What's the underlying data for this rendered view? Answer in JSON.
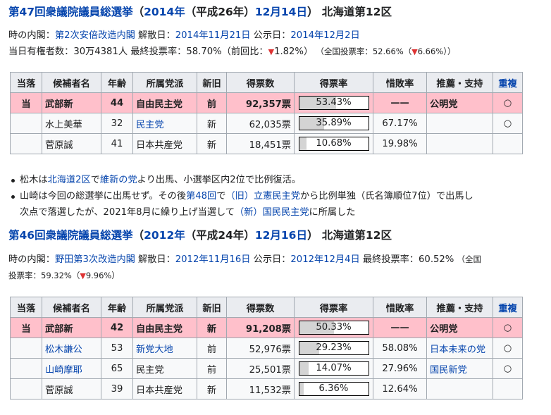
{
  "e47": {
    "heading": {
      "title": "第47回衆議院議員総選挙",
      "p1": "（",
      "year": "2014年",
      "era": "（平成26年）",
      "date": "12月14日",
      "p2": "）",
      "district": "北海道第12区"
    },
    "info": {
      "cabinet_label": "時の内閣：",
      "cabinet": "第2次安倍改造内閣",
      "dissolution_label": "解散日：",
      "dissolution": "2014年11月21日",
      "notice_label": "公示日：",
      "notice": "2014年12月2日"
    },
    "turnout": {
      "voters_label": "当日有権者数：",
      "voters": "30万4381人",
      "rate_label": "最終投票率：",
      "rate": "58.70%",
      "prev_open": "（前回比：",
      "prev_arrow": "▼",
      "prev_value": "1.82%",
      "prev_close": "）",
      "national_open": "（全国投票率：52.66%（",
      "national_arrow": "▼",
      "national_value": "6.66%",
      "national_close": "））"
    },
    "table": {
      "headers": [
        "当落",
        "候補者名",
        "年齢",
        "所属党派",
        "新旧",
        "得票数",
        "得票率",
        "惜敗率",
        "推薦・支持",
        "重複"
      ],
      "rows": [
        {
          "result": "当",
          "name": "武部新",
          "age": "44",
          "party": "自由民主党",
          "status": "前",
          "votes": "92,357票",
          "rate": "53.43%",
          "rate_value": 53.43,
          "loss": "——",
          "support": "公明党",
          "dup": "○"
        },
        {
          "result": "",
          "name": "水上美華",
          "age": "32",
          "party": "民主党",
          "status": "新",
          "votes": "62,035票",
          "rate": "35.89%",
          "rate_value": 35.89,
          "loss": "67.17%",
          "support": "",
          "dup": "○"
        },
        {
          "result": "",
          "name": "菅原誠",
          "age": "41",
          "party": "日本共産党",
          "status": "新",
          "votes": "18,451票",
          "rate": "10.68%",
          "rate_value": 10.68,
          "loss": "19.98%",
          "support": "",
          "dup": ""
        }
      ]
    },
    "notes": [
      {
        "a": "松木は",
        "l1": "北海道2区",
        "b": "で",
        "l2": "維新の党",
        "c": "より出馬、小選挙区内2位で比例復活。"
      },
      {
        "a": "山崎は今回の総選挙に出馬せず。その後",
        "l1": "第48回",
        "b": "で",
        "l2": "（旧）立憲民主党",
        "c": "から比例単独（氏名簿順位7位）で出馬し",
        "d": "次点で落選したが、2021年8月に繰り上げ当選して",
        "l3": "（新）国民民主党",
        "e": "に所属した"
      }
    ]
  },
  "e46": {
    "heading": {
      "title": "第46回衆議院議員総選挙",
      "p1": "（",
      "year": "2012年",
      "era": "（平成24年）",
      "date": "12月16日",
      "p2": "）",
      "district": "北海道第12区"
    },
    "info": {
      "cabinet_label": "時の内閣：",
      "cabinet": "野田第3次改造内閣",
      "dissolution_label": "解散日：",
      "dissolution": "2012年11月16日",
      "notice_label": "公示日：",
      "notice": "2012年12月4日",
      "rate_label": "最終投票率：",
      "rate": "60.52%",
      "national_open": "（全国",
      "national_cont": "投票率：59.32%（",
      "national_arrow": "▼",
      "national_value": "9.96%",
      "national_close": "）"
    },
    "table": {
      "headers": [
        "当落",
        "候補者名",
        "年齢",
        "所属党派",
        "新旧",
        "得票数",
        "得票率",
        "惜敗率",
        "推薦・支持",
        "重複"
      ],
      "rows": [
        {
          "result": "当",
          "name": "武部新",
          "age": "42",
          "party": "自由民主党",
          "status": "新",
          "votes": "91,208票",
          "rate": "50.33%",
          "rate_value": 50.33,
          "loss": "——",
          "support": "公明党",
          "dup": "○"
        },
        {
          "result": "",
          "name": "松木謙公",
          "age": "53",
          "party": "新党大地",
          "status": "前",
          "votes": "52,976票",
          "rate": "29.23%",
          "rate_value": 29.23,
          "loss": "58.08%",
          "support": "日本未来の党",
          "dup": "○"
        },
        {
          "result": "",
          "name": "山崎摩耶",
          "age": "65",
          "party": "民主党",
          "status": "前",
          "votes": "25,501票",
          "rate": "14.07%",
          "rate_value": 14.07,
          "loss": "27.96%",
          "support": "国民新党",
          "dup": "○"
        },
        {
          "result": "",
          "name": "菅原誠",
          "age": "39",
          "party": "日本共産党",
          "status": "新",
          "votes": "11,532票",
          "rate": "6.36%",
          "rate_value": 6.36,
          "loss": "12.64%",
          "support": "",
          "dup": ""
        }
      ]
    }
  }
}
